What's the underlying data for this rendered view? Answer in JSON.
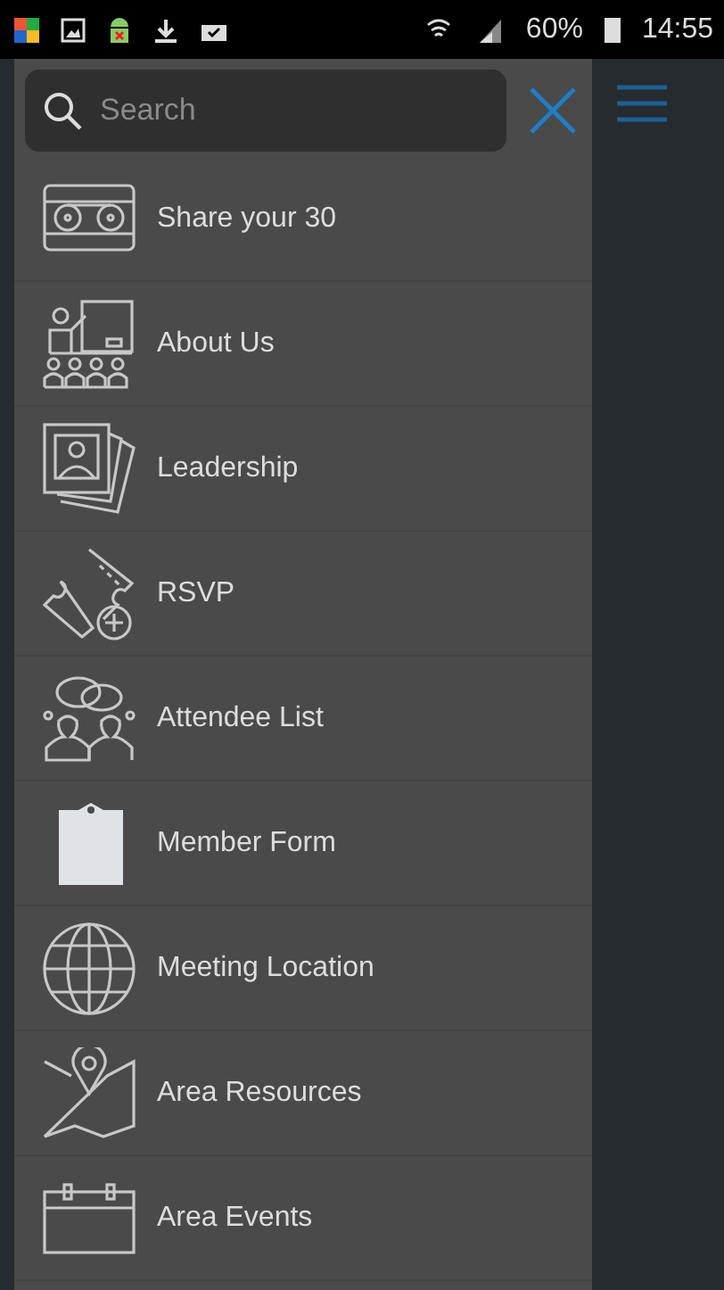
{
  "status_bar": {
    "battery": "60%",
    "time": "14:55"
  },
  "search": {
    "placeholder": "Search"
  },
  "menu": [
    {
      "label": "Share your 30"
    },
    {
      "label": "About Us"
    },
    {
      "label": "Leadership"
    },
    {
      "label": "RSVP"
    },
    {
      "label": "Attendee List"
    },
    {
      "label": "Member Form"
    },
    {
      "label": "Meeting Location"
    },
    {
      "label": "Area Resources"
    },
    {
      "label": "Area Events"
    }
  ]
}
